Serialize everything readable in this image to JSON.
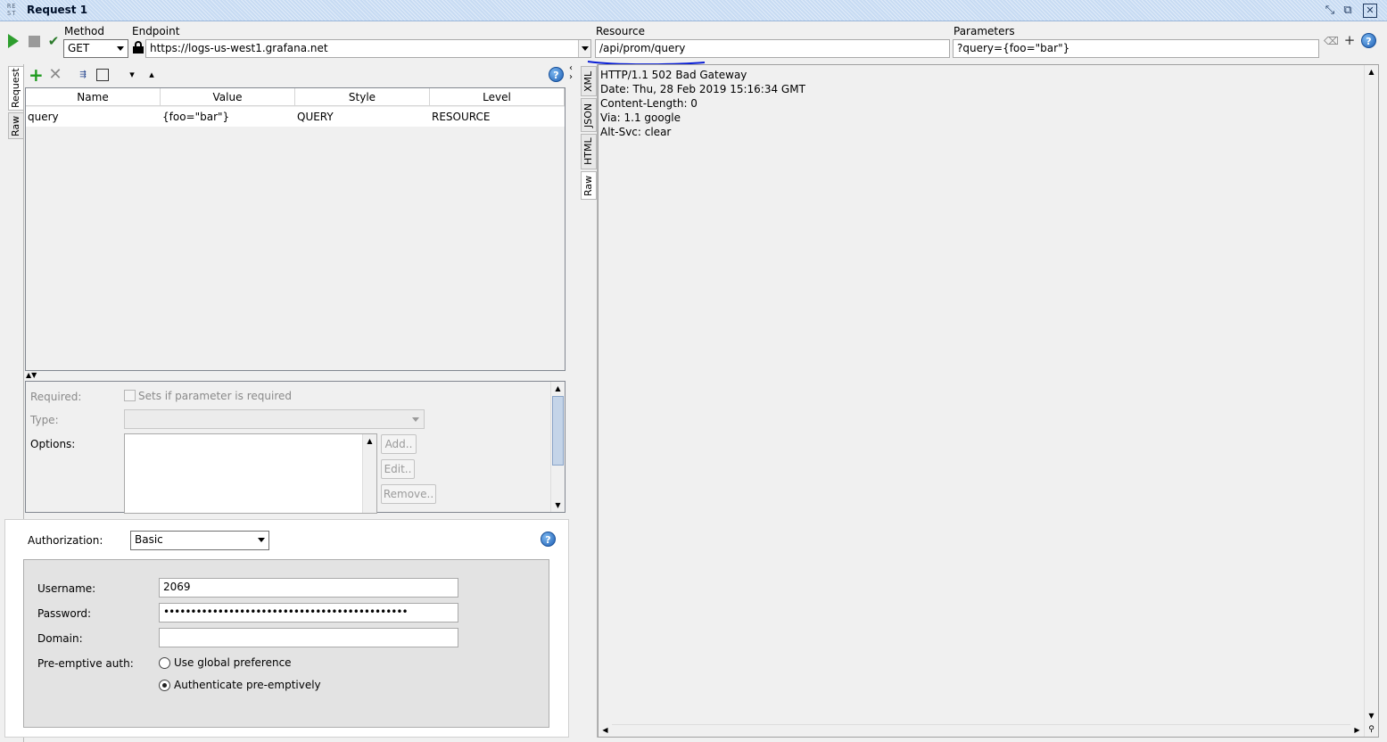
{
  "window": {
    "icon_text": "RE ST",
    "title": "Request 1",
    "buttons": {
      "restore": "⤡",
      "detach": "⧉",
      "close": "✕"
    }
  },
  "toolbar": {
    "method_label": "Method",
    "method_value": "GET",
    "endpoint_label": "Endpoint",
    "endpoint_value": "https://logs-us-west1.grafana.net",
    "resource_label": "Resource",
    "resource_value": "/api/prom/query",
    "parameters_label": "Parameters",
    "parameters_value": "?query={foo=\"bar\"}",
    "icons": [
      "play-icon",
      "stop-icon",
      "check-icon",
      "lock-icon",
      "clear-icon",
      "plus-icon",
      "help-icon"
    ]
  },
  "request_panel": {
    "tabs": [
      "Request",
      "Raw"
    ],
    "table": {
      "headers": [
        "Name",
        "Value",
        "Style",
        "Level"
      ],
      "rows": [
        [
          "query",
          "{foo=\"bar\"}",
          "QUERY",
          "RESOURCE"
        ]
      ]
    },
    "details": {
      "required_label": "Required:",
      "required_checkbox": "Sets if parameter is required",
      "type_label": "Type:",
      "options_label": "Options:",
      "add_button": "Add..",
      "edit_button": "Edit..",
      "remove_button": "Remove.."
    }
  },
  "auth": {
    "authorization_label": "Authorization:",
    "authorization_value": "Basic",
    "username_label": "Username:",
    "username_value": "2069",
    "password_label": "Password:",
    "password_value": "•••••••••••••••••••••••••••••••••••••••••••••",
    "domain_label": "Domain:",
    "domain_value": "",
    "preemptive_label": "Pre-emptive auth:",
    "option_global": "Use global preference",
    "option_preemptive": "Authenticate pre-emptively",
    "selected_option": "Authenticate pre-emptively"
  },
  "response_panel": {
    "tabs": [
      "XML",
      "JSON",
      "HTML",
      "Raw"
    ],
    "active_tab": "Raw",
    "lines": [
      "HTTP/1.1 502 Bad Gateway",
      "Date: Thu, 28 Feb 2019 15:16:34 GMT",
      "Content-Length: 0",
      "Via: 1.1 google",
      "Alt-Svc: clear"
    ]
  },
  "colors": {
    "title_bar": "#c7dbf3",
    "play_green": "#2e9e2e",
    "annotation_blue": "#0a1fd6",
    "help_blue": "#1e5fb4"
  }
}
